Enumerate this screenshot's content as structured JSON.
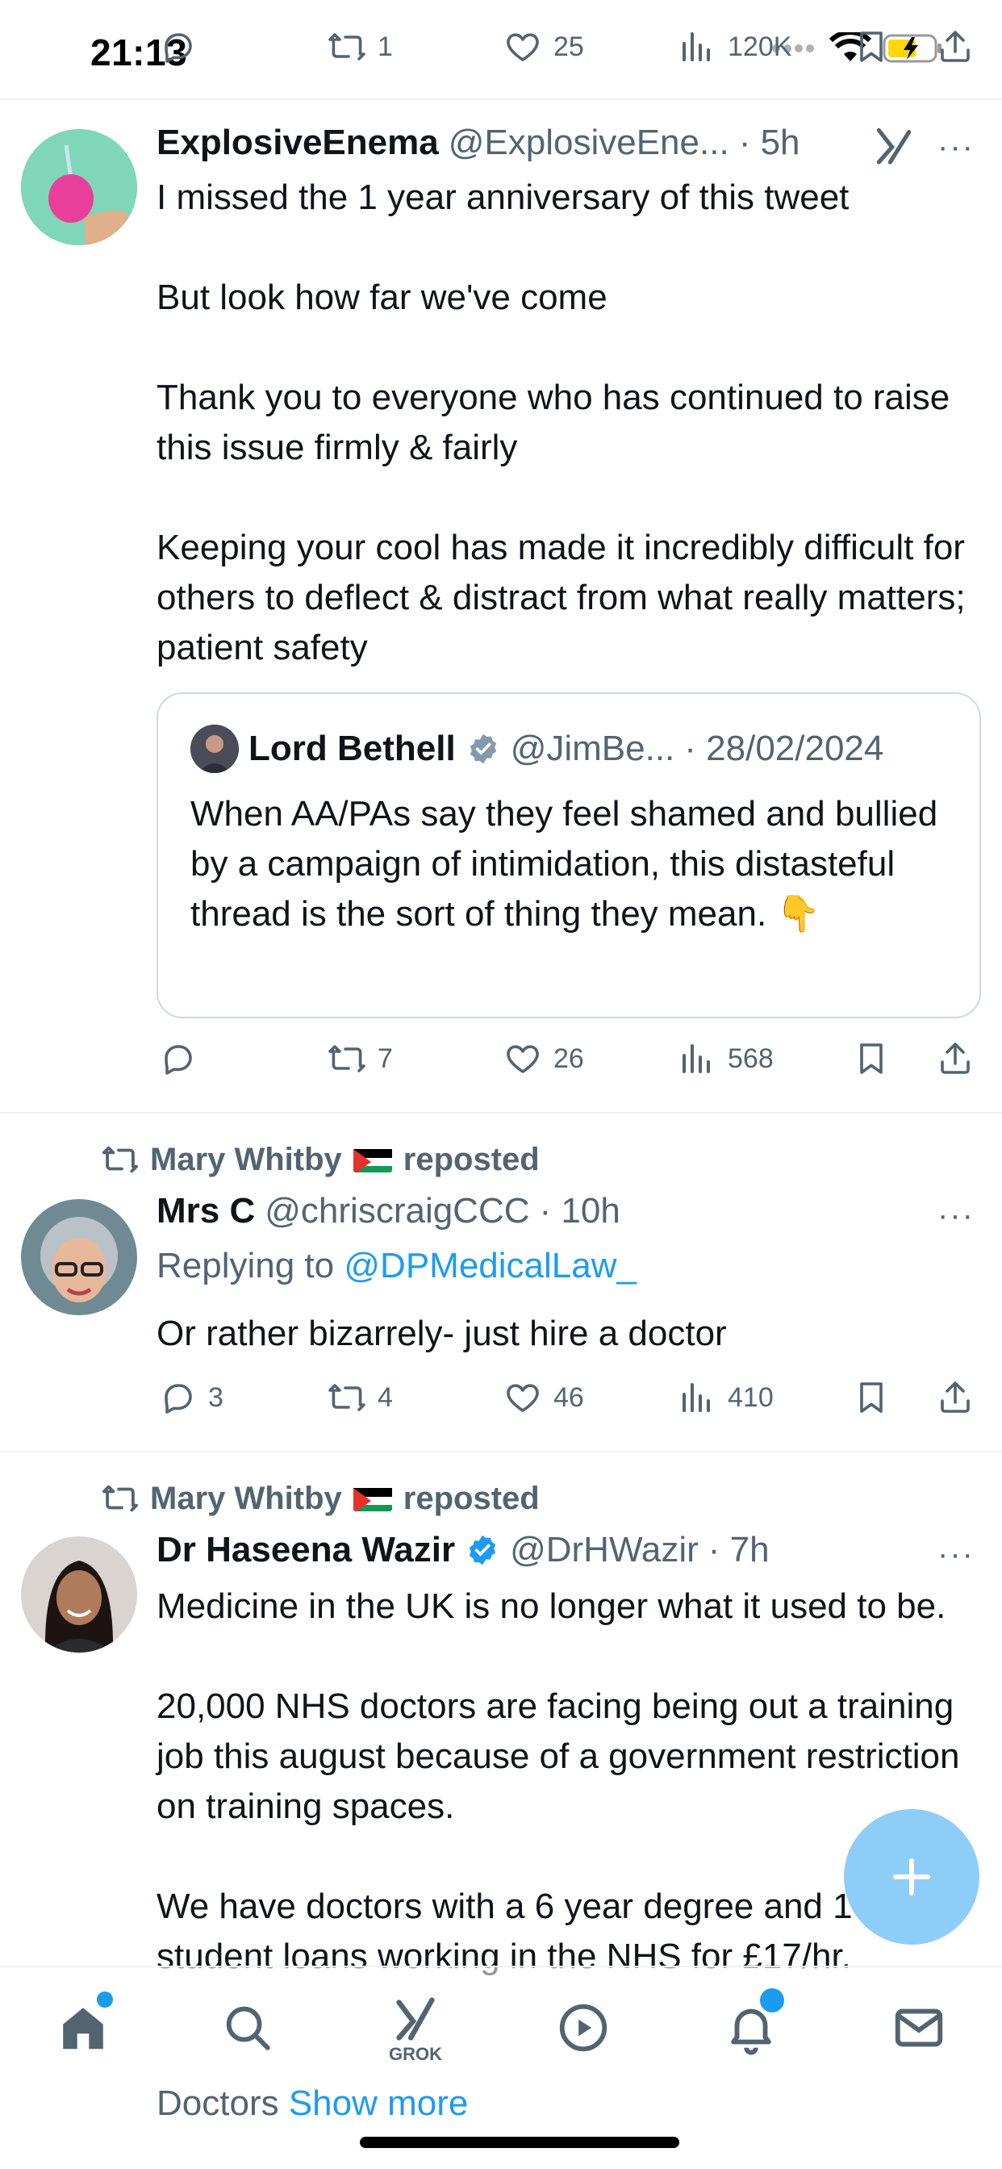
{
  "status_bar": {
    "time": "21:13"
  },
  "top_actions": {
    "retweets": "1",
    "likes": "25",
    "views": "120K"
  },
  "tweet1": {
    "name": "ExplosiveEnema",
    "handle": "@ExplosiveEne...",
    "time": "· 5h",
    "text": "I missed the 1 year anniversary of this tweet\n\nBut look how far we've come\n\nThank you to everyone who has continued to raise this issue firmly & fairly\n\nKeeping your cool has made it incredibly difficult for others to deflect & distract from what really matters; patient safety",
    "quote": {
      "name": "Lord Bethell",
      "handle": "@JimBe...",
      "date": "· 28/02/2024",
      "text": "When AA/PAs say they feel shamed and bullied by a campaign of intimidation, this distasteful thread is the sort of thing they mean.  👇"
    },
    "actions": {
      "retweets": "7",
      "likes": "26",
      "views": "568"
    }
  },
  "tweet2": {
    "reposted_by": "Mary Whitby",
    "reposted_label": "reposted",
    "name": "Mrs C",
    "handle": "@chriscraigCCC",
    "time": "· 10h",
    "replying_prefix": "Replying to",
    "replying_to": "@DPMedicalLaw_",
    "text": "Or rather bizarrely- just hire a doctor",
    "actions": {
      "replies": "3",
      "retweets": "4",
      "likes": "46",
      "views": "410"
    }
  },
  "tweet3": {
    "reposted_by": "Mary Whitby",
    "reposted_label": "reposted",
    "name": "Dr Haseena Wazir",
    "handle": "@DrHWazir",
    "time": "· 7h",
    "text": "Medicine in the UK is no longer what it used to be.\n\n20,000 NHS doctors are facing being out a training job this august because of a government restriction on training spaces.\n\nWe have doctors with a 6 year degree and 100k student loans working in the NHS for £17/hr.",
    "trailing": "Doctors",
    "show_more": "Show more"
  },
  "tab_bar": {
    "grok_label": "GROK"
  },
  "colors": {
    "accent": "#1d9bf0",
    "muted": "#536471",
    "text": "#0f1419"
  }
}
